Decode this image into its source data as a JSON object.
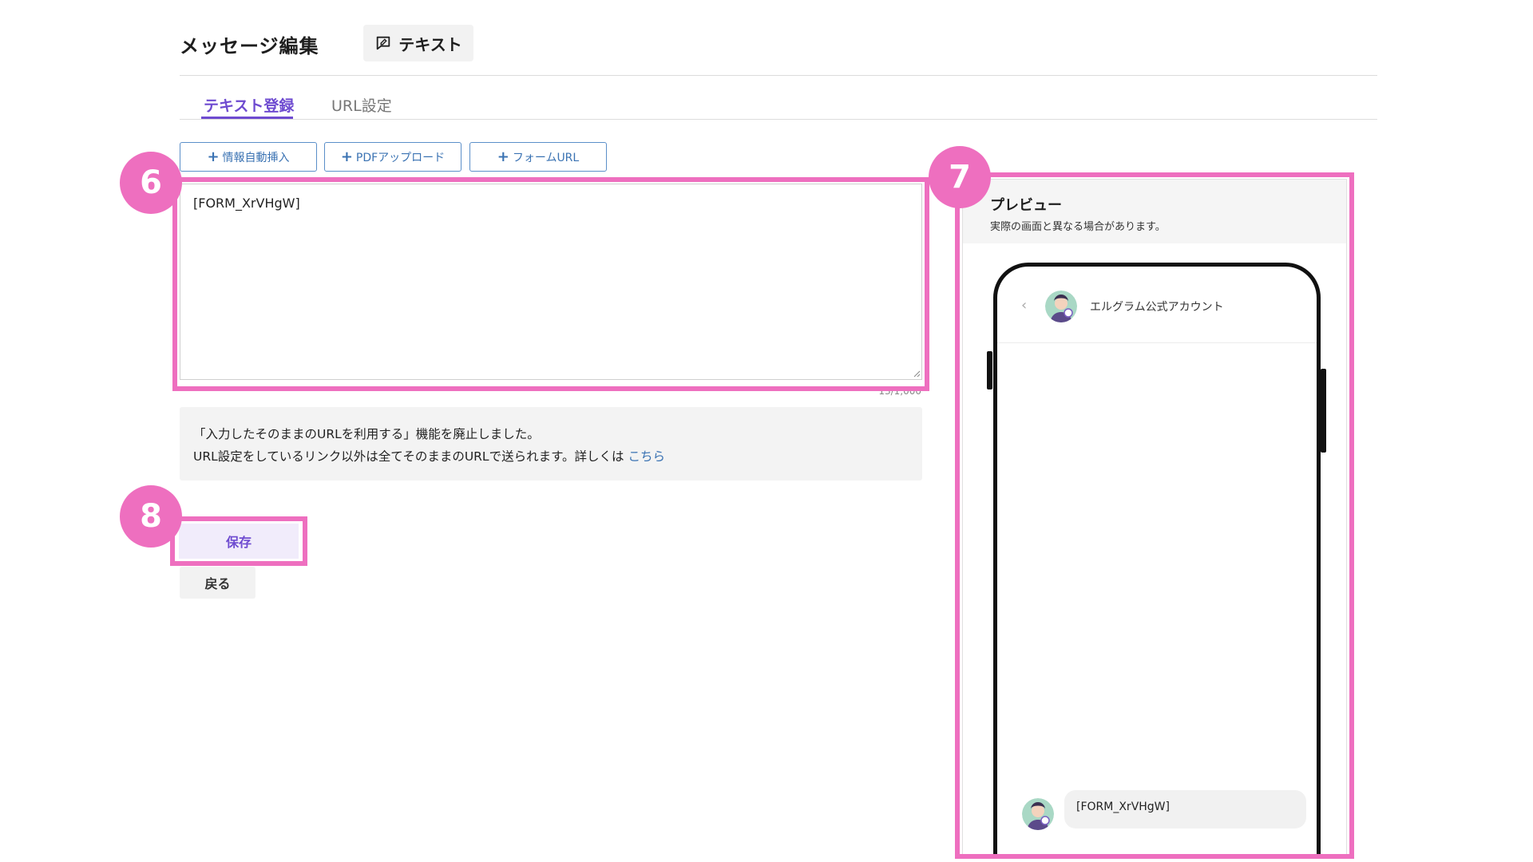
{
  "header": {
    "title": "メッセージ編集",
    "type_chip_label": "テキスト",
    "type_chip_icon": "chat-edit-icon"
  },
  "tabs": [
    {
      "label": "テキスト登録",
      "active": true
    },
    {
      "label": "URL設定",
      "active": false
    }
  ],
  "insert_buttons": [
    {
      "plus": "+",
      "label": "情報自動挿入"
    },
    {
      "plus": "+",
      "label": "PDFアップロード"
    },
    {
      "plus": "+",
      "label": "フォームURL"
    }
  ],
  "editor": {
    "value": "[FORM_XrVHgW]",
    "counter": "13/1,000"
  },
  "notice": {
    "line1": "「入力したそのままのURLを利用する」機能を廃止しました。",
    "line2": "URL設定をしているリンク以外は全てそのままのURLで送られます。詳しくは",
    "link": "こちら"
  },
  "actions": {
    "save_label": "保存",
    "back_label": "戻る"
  },
  "preview": {
    "title": "プレビュー",
    "subtitle": "実際の画面と異なる場合があります。",
    "back_icon": "‹",
    "account_name": "エルグラム公式アカウント",
    "message": "[FORM_XrVHgW]"
  },
  "annotations": {
    "badge_editor": "6",
    "badge_preview": "7",
    "badge_save": "8",
    "color": "#ee6fbf"
  },
  "colors": {
    "accent_purple": "#6e4bd0",
    "link_blue": "#3b73b3"
  }
}
